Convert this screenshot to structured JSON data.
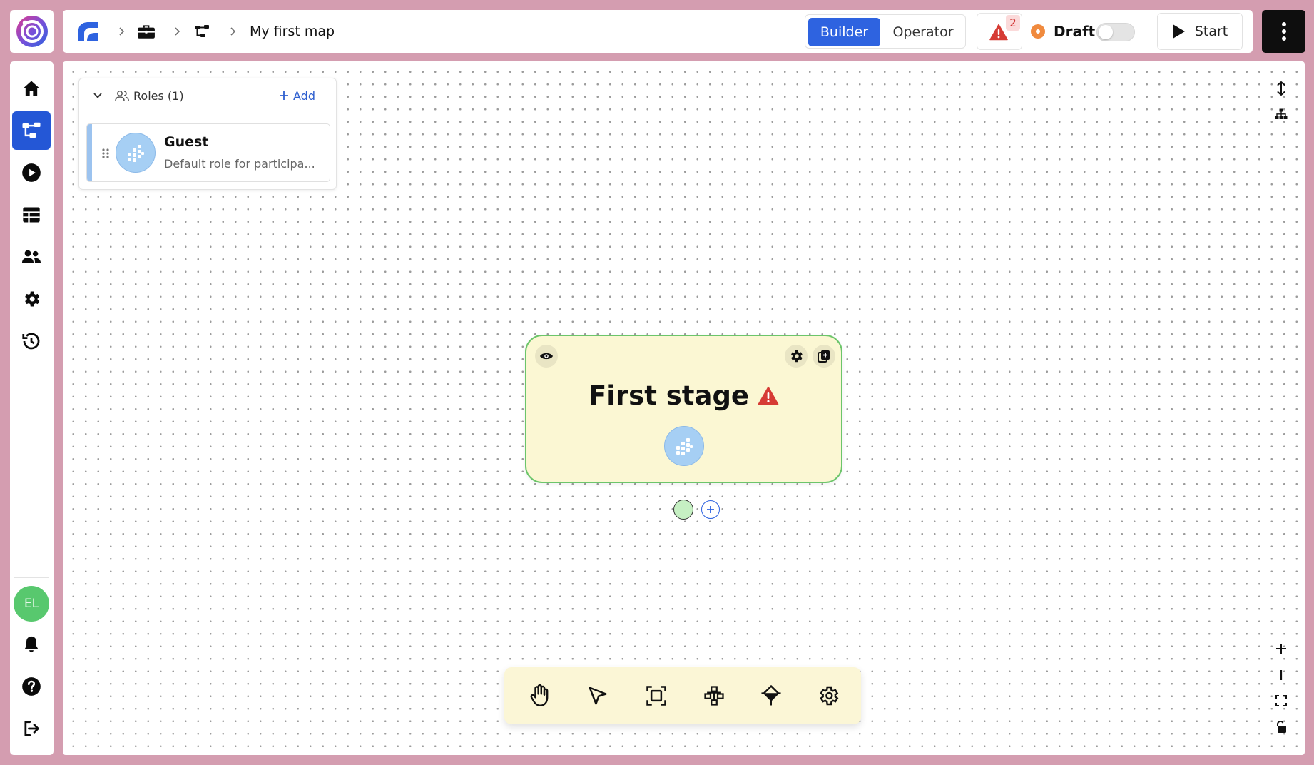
{
  "app": {
    "logo_icon": "ring-logo-icon",
    "brand_color": "#2e63e0",
    "background_color": "#d49db0"
  },
  "sidebar": {
    "items": [
      {
        "id": "home",
        "icon": "home-icon",
        "active": false
      },
      {
        "id": "map",
        "icon": "flowchart-icon",
        "active": true
      },
      {
        "id": "run",
        "icon": "play-circle-icon",
        "active": false
      },
      {
        "id": "data",
        "icon": "table-icon",
        "active": false
      },
      {
        "id": "people",
        "icon": "users-icon",
        "active": false
      },
      {
        "id": "settings",
        "icon": "gear-icon",
        "active": false
      },
      {
        "id": "history",
        "icon": "history-icon",
        "active": false
      }
    ],
    "avatar_initials": "EL",
    "avatar_color": "#58c86e",
    "bottom_items": [
      {
        "id": "notifications",
        "icon": "bell-icon"
      },
      {
        "id": "help",
        "icon": "help-icon"
      },
      {
        "id": "logout",
        "icon": "logout-icon"
      }
    ]
  },
  "topbar": {
    "breadcrumb": [
      {
        "icon": "workspace-logo-icon"
      },
      {
        "icon": "briefcase-icon"
      },
      {
        "icon": "flowchart-icon"
      }
    ],
    "title": "My first map",
    "modes": {
      "builder": "Builder",
      "operator": "Operator",
      "selected": "builder"
    },
    "issues_count": "2",
    "status_label": "Draft",
    "status_toggle_on": false,
    "start_label": "Start"
  },
  "roles_panel": {
    "title": "Roles (1)",
    "add_label": "Add",
    "roles": [
      {
        "name": "Guest",
        "description": "Default role for participa..."
      }
    ]
  },
  "stage": {
    "title": "First stage",
    "has_warning": true,
    "fill_color": "#fbf7d3",
    "border_color": "#6cc56a"
  },
  "toolbar": {
    "tools": [
      {
        "id": "pan",
        "icon": "hand-icon"
      },
      {
        "id": "select",
        "icon": "pointer-icon"
      },
      {
        "id": "frame",
        "icon": "frame-select-icon"
      },
      {
        "id": "layout",
        "icon": "hierarchy-icon"
      },
      {
        "id": "branch",
        "icon": "decision-icon"
      },
      {
        "id": "settings",
        "icon": "gear-icon"
      }
    ]
  },
  "canvas_controls": {
    "top": [
      {
        "id": "vertical-layout",
        "icon": "vertical-arrows-icon"
      },
      {
        "id": "tree-layout",
        "icon": "tree-icon"
      }
    ],
    "bottom": [
      {
        "id": "zoom-in",
        "icon": "plus-icon"
      },
      {
        "id": "zoom-out",
        "icon": "minus-icon"
      },
      {
        "id": "fit-view",
        "icon": "fit-view-icon"
      },
      {
        "id": "lock",
        "icon": "lock-icon"
      }
    ]
  }
}
